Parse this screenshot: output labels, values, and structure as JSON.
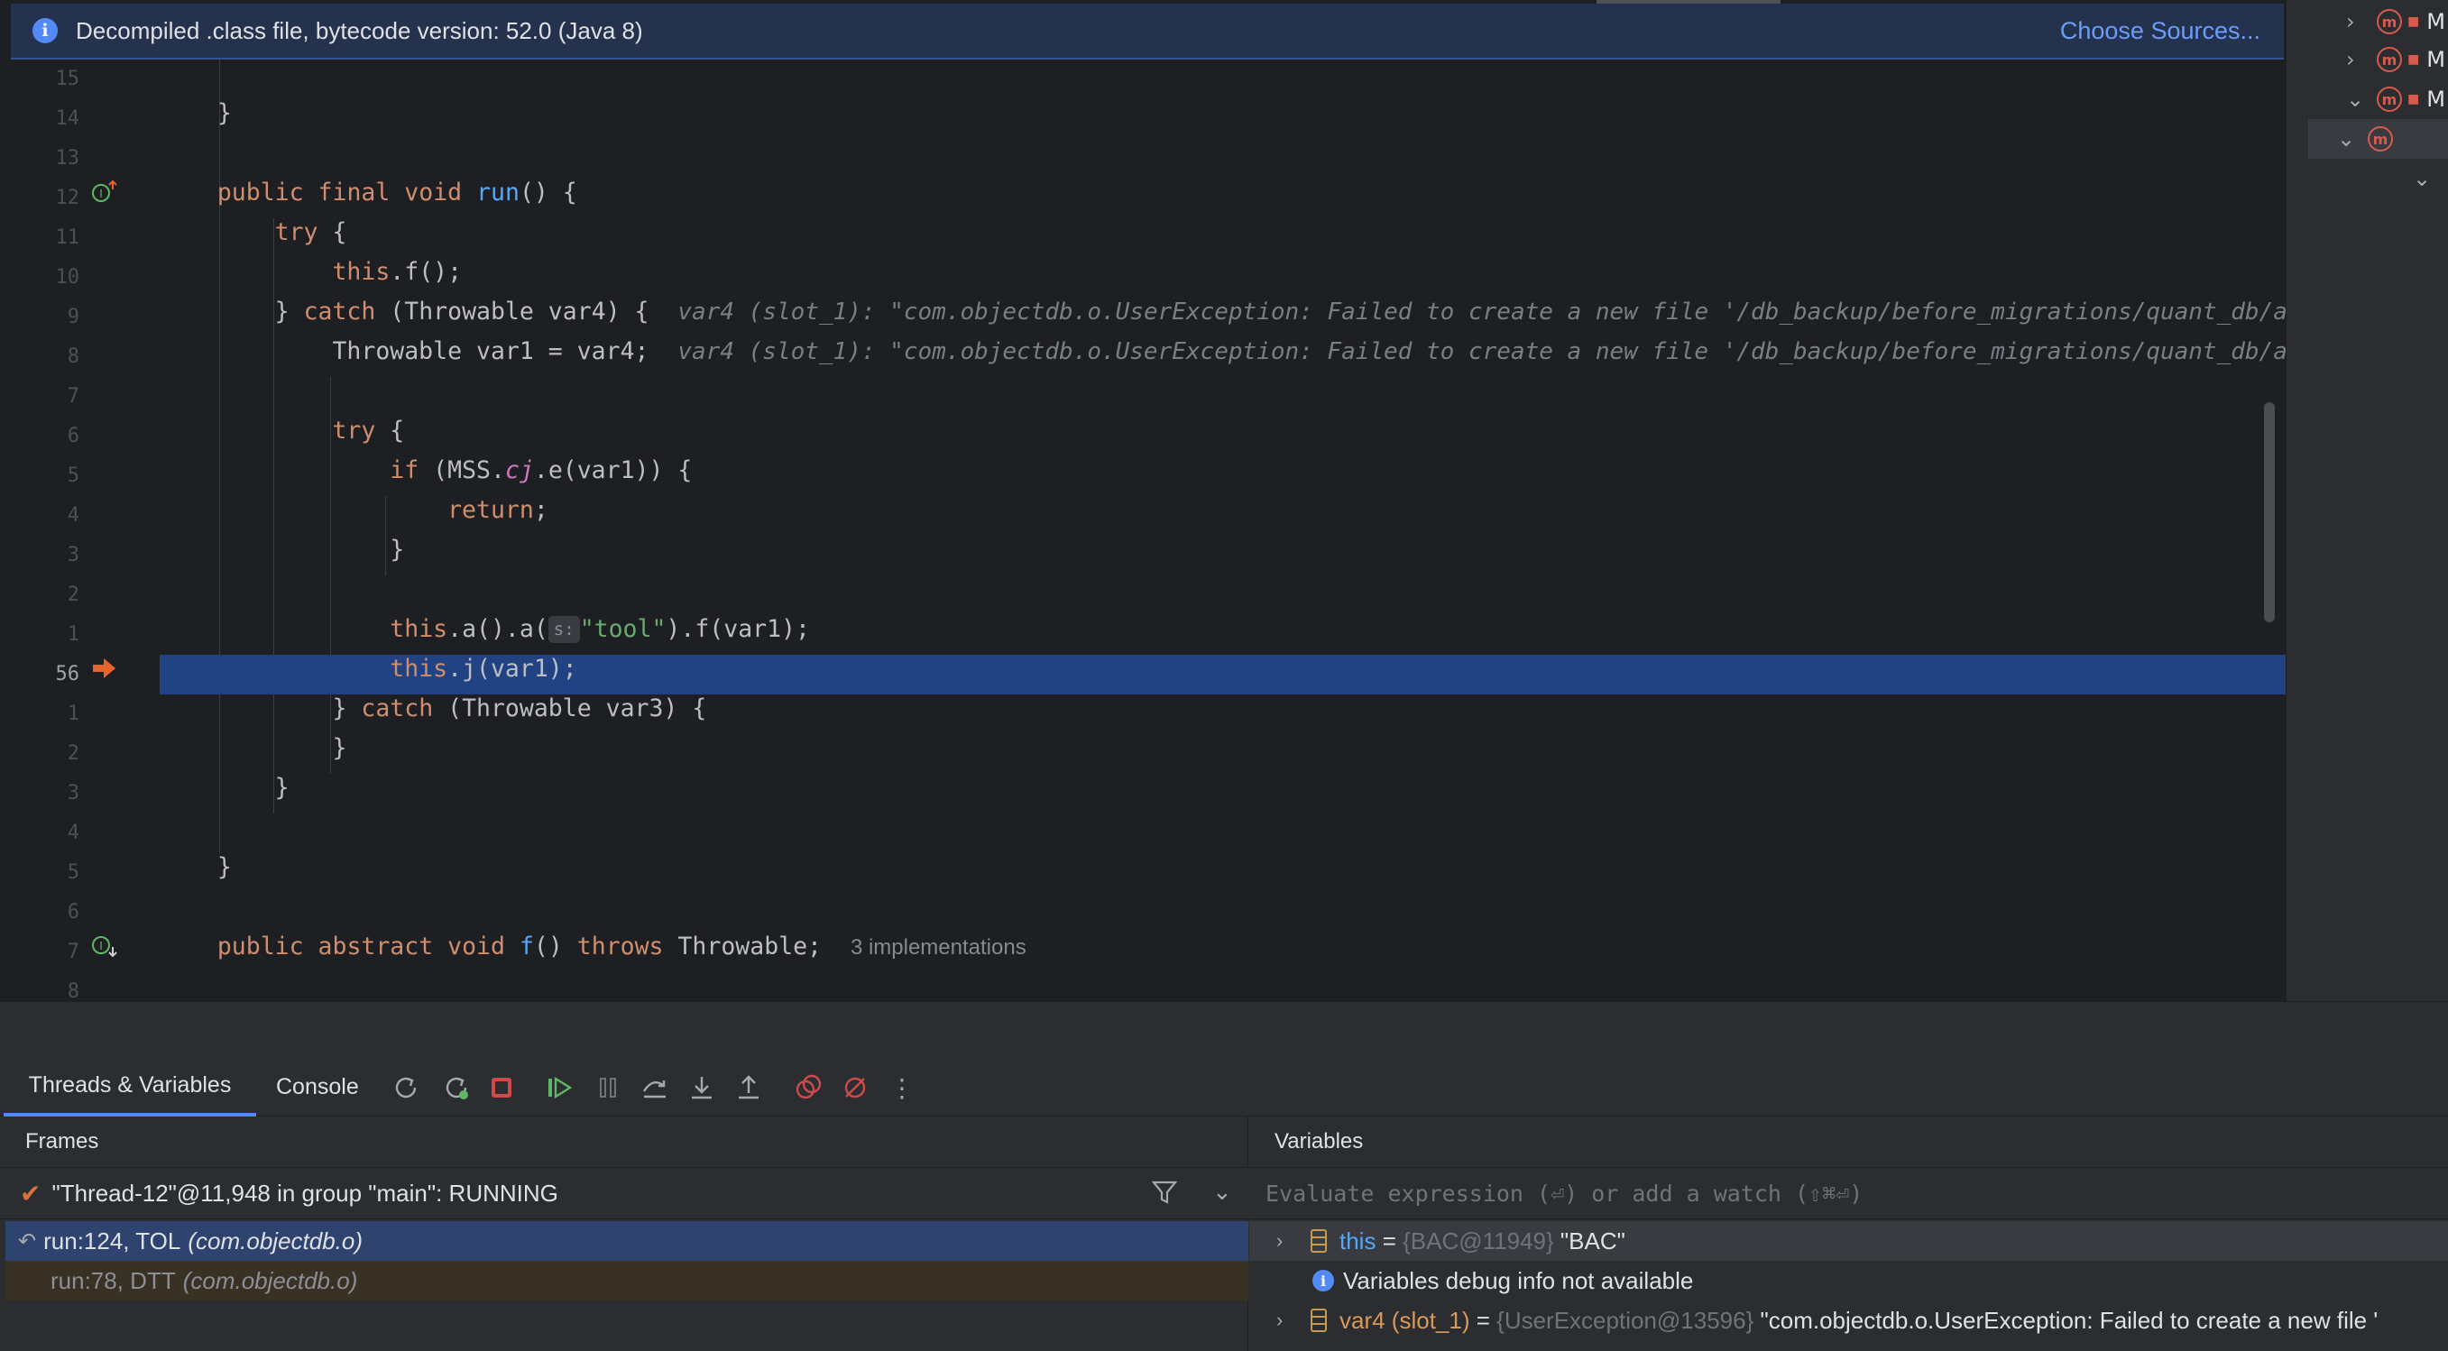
{
  "banner": {
    "message": "Decompiled .class file, bytecode version: 52.0 (Java 8)",
    "link": "Choose Sources..."
  },
  "gutter": {
    "line_numbers": [
      "15",
      "14",
      "13",
      "12",
      "11",
      "10",
      "9",
      "8",
      "7",
      "6",
      "5",
      "4",
      "3",
      "2",
      "1",
      "56",
      "1",
      "2",
      "3",
      "4",
      "5",
      "6",
      "7",
      "8"
    ]
  },
  "code": {
    "l_brace_close": "}",
    "run_kw1": "public",
    "run_kw2": "final",
    "run_kw3": "void",
    "run_name": "run",
    "run_rest": "() {",
    "try_kw": "try",
    "try_brace": " {",
    "this_kw": "this",
    "call_f": ".f();",
    "catch_close": "} ",
    "catch_kw": "catch",
    "catch_rest": " (Throwable var4) {",
    "inlay_var4": "var4 (slot_1): \"com.objectdb.o.UserException: Failed to create a new file '/db_backup/before_migrations/quant_db/a",
    "assign": "Throwable var1 = var4;",
    "if_kw": "if",
    "if_rest1": " (MSS.",
    "if_field": "cj",
    "if_rest2": ".e(var1)) {",
    "return_kw": "return",
    "return_semi": ";",
    "a_call1": ".a().a(",
    "param_hint": "s:",
    "tool_str": "\"tool\"",
    "a_call2": ").f(var1);",
    "j_call": ".j(var1);",
    "catch2_rest": " (Throwable var3) {",
    "abs_kw1": "public",
    "abs_kw2": "abstract",
    "abs_kw3": "void",
    "abs_name": "f",
    "abs_rest1": "() ",
    "throws_kw": "throws",
    "abs_rest2": " Throwable;",
    "implementations": "3 implementations"
  },
  "debug": {
    "tabs": [
      "Threads & Variables",
      "Console"
    ],
    "frames_title": "Frames",
    "variables_title": "Variables",
    "thread": "\"Thread-12\"@11,948 in group \"main\": RUNNING",
    "frames": [
      {
        "method": "run:124, TOL",
        "cls": "(com.objectdb.o)"
      },
      {
        "method": "run:78, DTT",
        "cls": "(com.objectdb.o)"
      }
    ],
    "eval_placeholder": "Evaluate expression (⏎) or add a watch (⇧⌘⏎)",
    "vars": {
      "this_name": "this",
      "this_eq": " = ",
      "this_ref": "{BAC@11949}",
      "this_val": " \"BAC\"",
      "info": "Variables debug info not available",
      "var4_name": "var4 (slot_1)",
      "var4_eq": " = ",
      "var4_ref": "{UserException@13596}",
      "var4_val": " \"com.objectdb.o.UserException: Failed to create a new file '"
    }
  },
  "project": {
    "items": [
      "M",
      "M",
      "M"
    ]
  },
  "colors": {
    "keyword": "#cf8e6d",
    "function": "#56a8f5",
    "string": "#6aab73",
    "highlight": "#214283",
    "breakpoint": "#e8642f"
  },
  "icons": [
    "info-icon",
    "override-icon",
    "implemented-icon",
    "execution-point-icon",
    "rerun-icon",
    "restart-icon",
    "stop-icon",
    "resume-icon",
    "pause-icon",
    "step-over-icon",
    "step-into-icon",
    "step-out-icon",
    "view-breakpoints-icon",
    "mute-breakpoints-icon",
    "more-icon",
    "filter-icon",
    "chevron-down-icon",
    "check-icon",
    "frame-return-icon",
    "field-icon"
  ]
}
